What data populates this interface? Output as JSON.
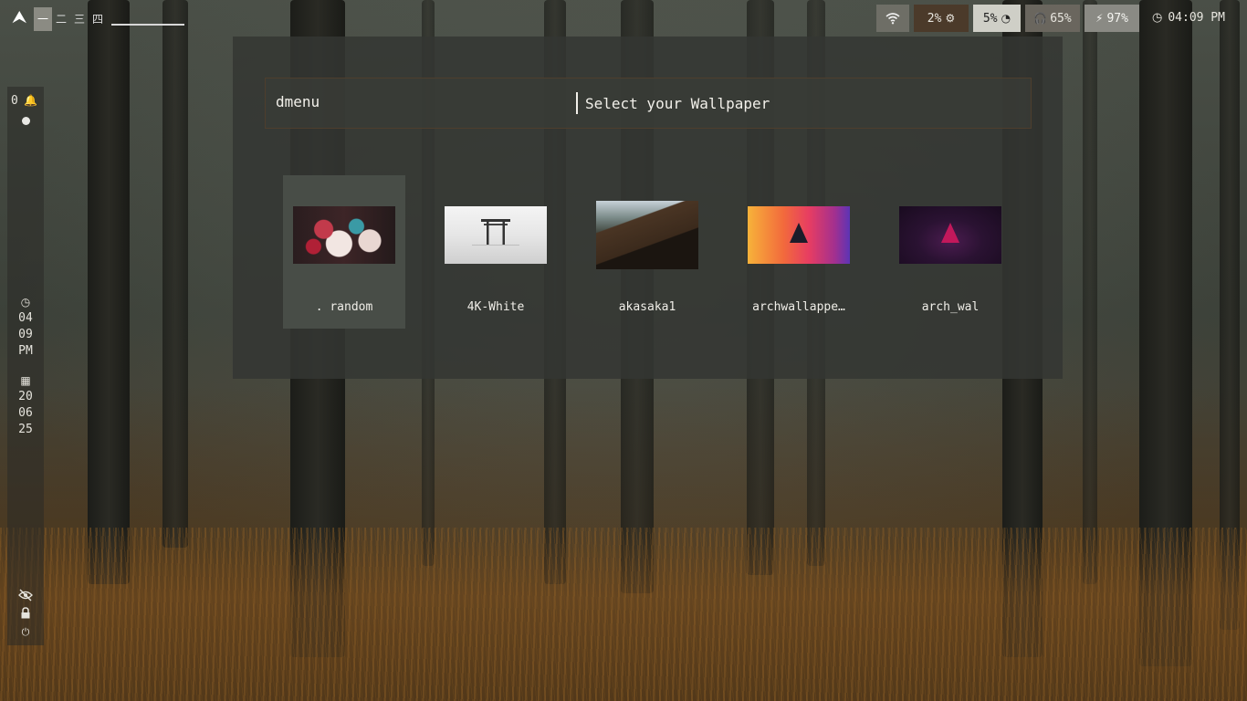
{
  "topbar": {
    "logo": "⮝",
    "workspaces": [
      "一",
      "二",
      "三",
      "四"
    ],
    "active_workspace": 0,
    "modules": {
      "wifi_icon": "wifi-icon",
      "cpu": "2%",
      "memory": "5%",
      "volume": "65%",
      "battery": "97%",
      "time": "04:09 PM"
    }
  },
  "sidebar": {
    "notification_count": "0",
    "clock": [
      "04",
      "09",
      "PM"
    ],
    "date": [
      "20",
      "06",
      "25"
    ]
  },
  "launcher": {
    "prompt": "dmenu",
    "placeholder": "Select your Wallpaper",
    "items": [
      {
        "label": ". random",
        "selected": true
      },
      {
        "label": "4K-White",
        "selected": false
      },
      {
        "label": "akasaka1",
        "selected": false
      },
      {
        "label": "archwallappe…",
        "selected": false
      },
      {
        "label": "arch_wal",
        "selected": false
      }
    ]
  },
  "colors": {
    "accent": "#8b8b83",
    "panel": "#34362f",
    "input_border": "#4e3e2d",
    "selected_item": "#484d47"
  }
}
